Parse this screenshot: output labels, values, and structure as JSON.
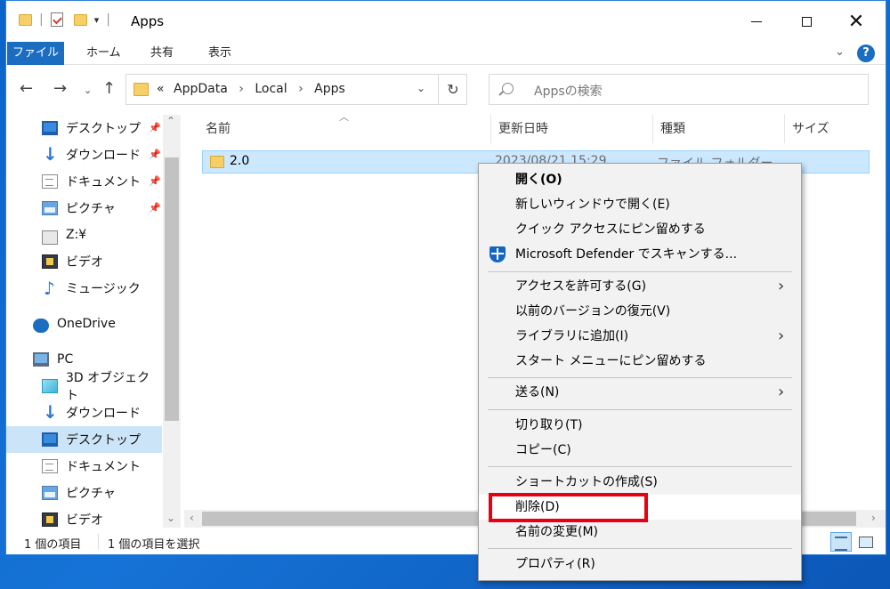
{
  "window": {
    "title": "Apps"
  },
  "ribbon": {
    "tabs": [
      {
        "label": "ファイル"
      },
      {
        "label": "ホーム"
      },
      {
        "label": "共有"
      },
      {
        "label": "表示"
      }
    ],
    "help": "?"
  },
  "address": {
    "prefix": "«",
    "path": [
      "AppData",
      "Local",
      "Apps"
    ],
    "separator": "›"
  },
  "search": {
    "placeholder": "Appsの検索"
  },
  "nav_pane": {
    "items": [
      {
        "label": "デスクトップ",
        "icon": "desktop-icon",
        "pinned": true
      },
      {
        "label": "ダウンロード",
        "icon": "download-icon",
        "pinned": true
      },
      {
        "label": "ドキュメント",
        "icon": "documents-icon",
        "pinned": true
      },
      {
        "label": "ピクチャ",
        "icon": "pictures-icon",
        "pinned": true
      },
      {
        "label": "Z:¥",
        "icon": "network-drive-icon"
      },
      {
        "label": "ビデオ",
        "icon": "videos-icon"
      },
      {
        "label": "ミュージック",
        "icon": "music-icon"
      },
      {
        "label": "OneDrive",
        "icon": "onedrive-icon"
      },
      {
        "label": "PC",
        "icon": "pc-icon"
      },
      {
        "label": "3D オブジェクト",
        "icon": "3d-objects-icon"
      },
      {
        "label": "ダウンロード",
        "icon": "download-icon"
      },
      {
        "label": "デスクトップ",
        "icon": "desktop-icon",
        "selected": true
      },
      {
        "label": "ドキュメント",
        "icon": "documents-icon"
      },
      {
        "label": "ピクチャ",
        "icon": "pictures-icon"
      },
      {
        "label": "ビデオ",
        "icon": "videos-icon"
      }
    ]
  },
  "file_list": {
    "columns": {
      "name": "名前",
      "date": "更新日時",
      "type": "種類",
      "size": "サイズ"
    },
    "rows": [
      {
        "name": "2.0",
        "date": "2023/08/21 15:29",
        "type": "ファイル フォルダー"
      }
    ]
  },
  "status": {
    "count": "1 個の項目",
    "selected": "1 個の項目を選択"
  },
  "context_menu": {
    "items": [
      {
        "label": "開く(O)",
        "bold": true
      },
      {
        "label": "新しいウィンドウで開く(E)"
      },
      {
        "label": "クイック アクセスにピン留めする"
      },
      {
        "label": "Microsoft Defender でスキャンする...",
        "icon": "defender-icon"
      },
      {
        "label": "アクセスを許可する(G)",
        "submenu": true
      },
      {
        "label": "以前のバージョンの復元(V)"
      },
      {
        "label": "ライブラリに追加(I)",
        "submenu": true
      },
      {
        "label": "スタート メニューにピン留めする"
      },
      {
        "label": "送る(N)",
        "submenu": true
      },
      {
        "label": "切り取り(T)"
      },
      {
        "label": "コピー(C)"
      },
      {
        "label": "ショートカットの作成(S)"
      },
      {
        "label": "削除(D)",
        "highlighted": true
      },
      {
        "label": "名前の変更(M)"
      },
      {
        "label": "プロパティ(R)"
      }
    ]
  },
  "colors": {
    "accent": "#1a6dc1",
    "selection": "#cce8ff",
    "highlight_box": "#e60012"
  }
}
